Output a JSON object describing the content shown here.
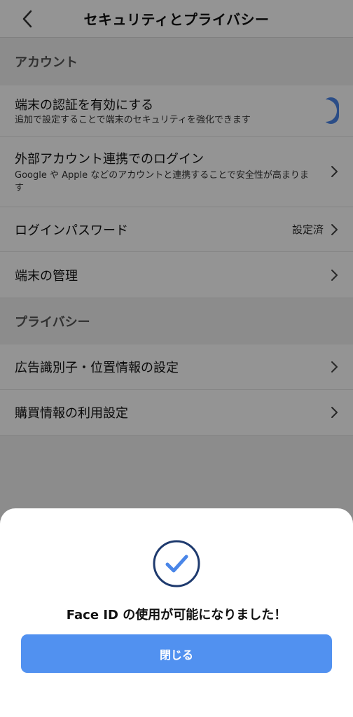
{
  "header": {
    "title": "セキュリティとプライバシー"
  },
  "account": {
    "label": "アカウント",
    "device_auth": {
      "title": "端末の認証を有効にする",
      "subtitle": "追加で設定することで端末のセキュリティを強化できます",
      "enabled": true
    },
    "external_login": {
      "title": "外部アカウント連携でのログイン",
      "subtitle": "Google や Apple などのアカウントと連携することで安全性が高まります"
    },
    "password": {
      "title": "ログインパスワード",
      "value": "設定済"
    },
    "device_manage": {
      "title": "端末の管理"
    }
  },
  "privacy": {
    "label": "プライバシー",
    "ad_location": {
      "title": "広告識別子・位置情報の設定"
    },
    "purchase_info": {
      "title": "購買情報の利用設定"
    }
  },
  "sheet": {
    "message": "Face ID の使用が可能になりました！",
    "close_label": "閉じる"
  },
  "colors": {
    "accent": "#4a86e8",
    "button": "#5191f0",
    "check_ring": "#1e3a6e",
    "check_mark": "#4a86e8"
  },
  "icons": [
    "back-chevron-icon",
    "chevron-right-icon",
    "check-circle-icon"
  ]
}
